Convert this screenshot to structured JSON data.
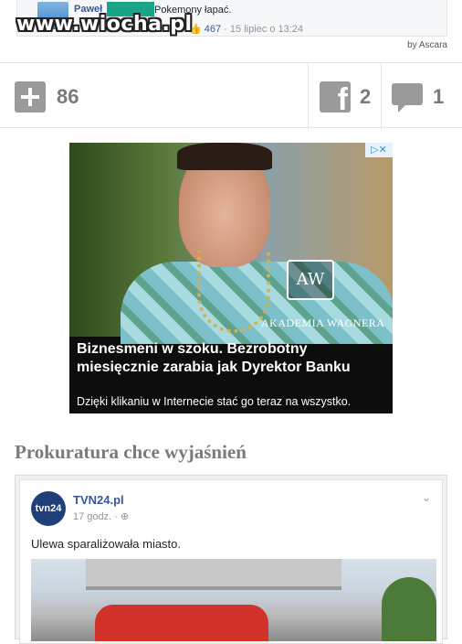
{
  "top_post": {
    "author": "Paweł",
    "text": "Pokemony łapać.",
    "like_count": "467",
    "timestamp": "15 lipiec o 13:24"
  },
  "watermark": "www.wiocha.pl",
  "by_line": "by Ascara",
  "actions": {
    "plus_count": "86",
    "facebook_count": "2",
    "comment_count": "1"
  },
  "ad": {
    "close_label": "▷✕",
    "badge": "AW",
    "badge_text": "AKADEMIA WAGNERA",
    "headline": "Biznesmeni w szoku. Bezrobotny miesięcznie zarabia jak Dyrektor Banku",
    "subtext": "Dzięki klikaniu w Internecie stać go teraz na wszystko."
  },
  "article": {
    "title": "Prokuratura chce wyjaśnień"
  },
  "embedded_post": {
    "avatar_text": "tvn24",
    "author": "TVN24.pl",
    "time": "17 godz. · ⊕",
    "text": "Ulewa sparaliżowała miasto."
  }
}
